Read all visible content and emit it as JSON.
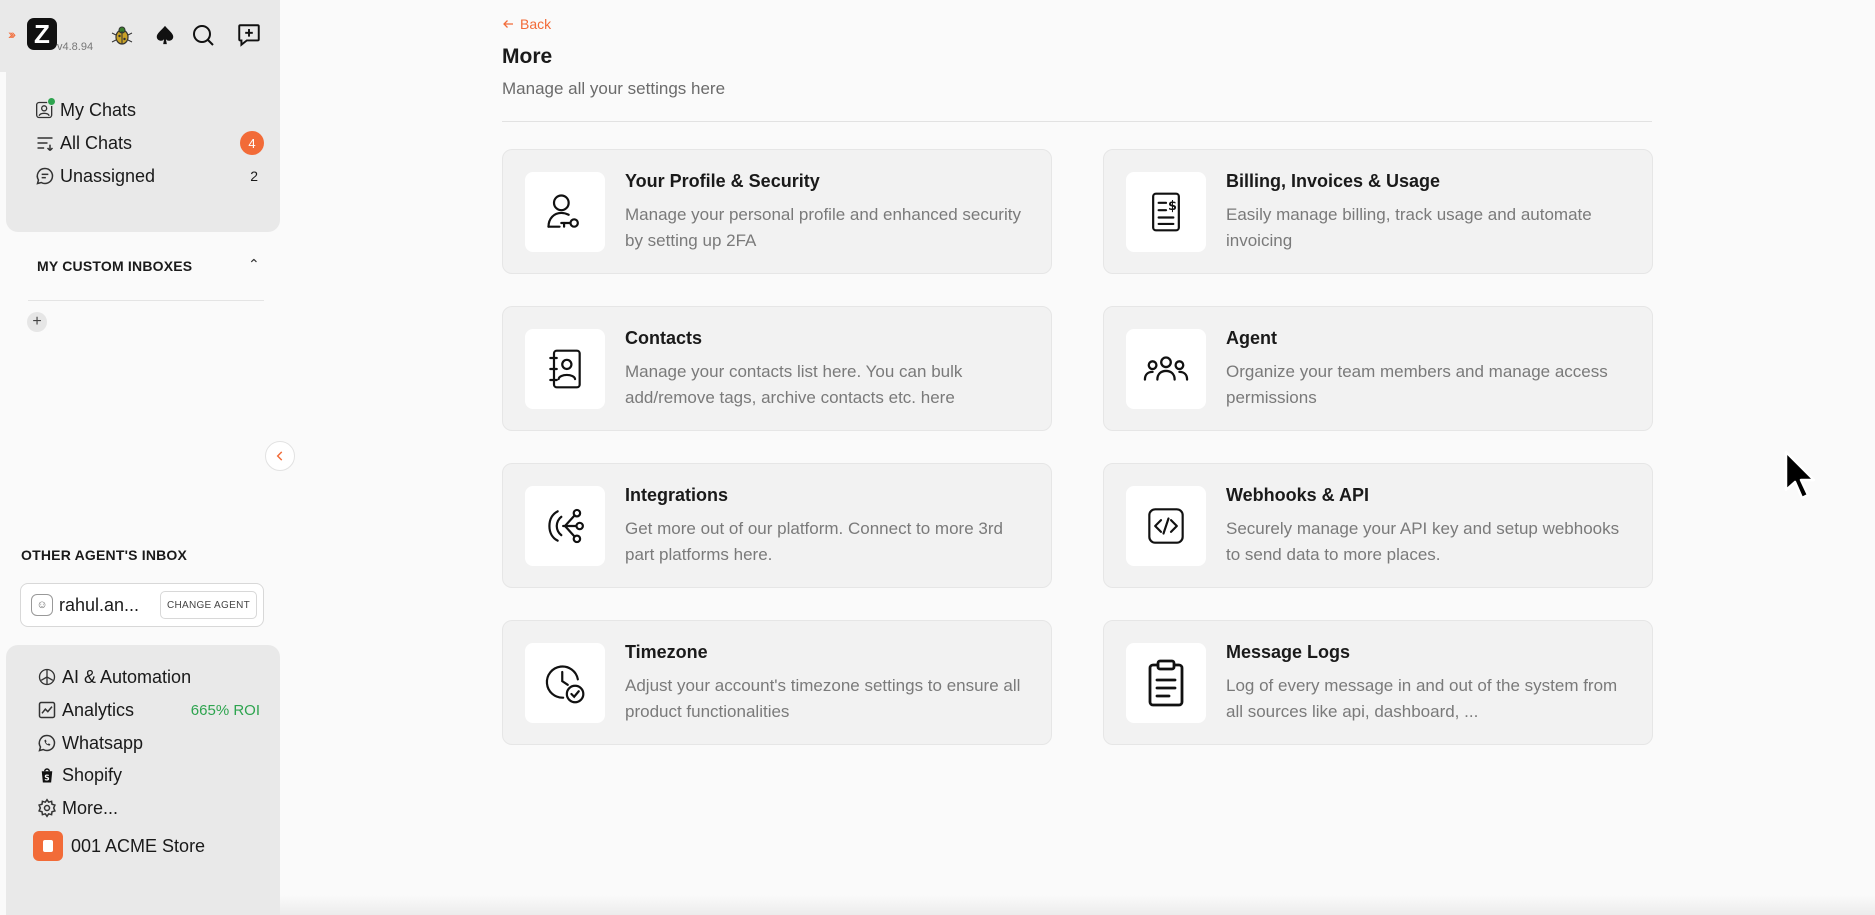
{
  "app": {
    "version": "v4.8.94"
  },
  "sidebar": {
    "nav": [
      {
        "label": "My Chats",
        "count": ""
      },
      {
        "label": "All Chats",
        "count": "4"
      },
      {
        "label": "Unassigned",
        "count": "2"
      }
    ],
    "custom_inboxes_title": "MY CUSTOM INBOXES",
    "other_agent_title": "OTHER AGENT'S INBOX",
    "agent_name": "rahul.an...",
    "change_agent_label": "CHANGE AGENT",
    "bottom": [
      {
        "label": "AI & Automation",
        "extra": ""
      },
      {
        "label": "Analytics",
        "extra": "665% ROI"
      },
      {
        "label": "Whatsapp",
        "extra": ""
      },
      {
        "label": "Shopify",
        "extra": ""
      },
      {
        "label": "More...",
        "extra": ""
      }
    ],
    "store_label": "001 ACME Store"
  },
  "main": {
    "back_label": "Back",
    "title": "More",
    "subtitle": "Manage all your settings here",
    "cards": [
      {
        "title": "Your Profile & Security",
        "desc": "Manage your personal profile and enhanced security by setting up 2FA",
        "icon": "profile-security-icon"
      },
      {
        "title": "Billing, Invoices & Usage",
        "desc": "Easily manage billing, track usage and automate invoicing",
        "icon": "billing-invoice-icon"
      },
      {
        "title": "Contacts",
        "desc": "Manage your contacts list here. You can bulk add/remove tags, archive contacts etc. here",
        "icon": "contacts-book-icon"
      },
      {
        "title": "Agent",
        "desc": "Organize your team members and manage access permissions",
        "icon": "team-agents-icon"
      },
      {
        "title": "Integrations",
        "desc": "Get more out of our platform. Connect to more 3rd part platforms here.",
        "icon": "integrations-icon"
      },
      {
        "title": "Webhooks & API",
        "desc": "Securely manage your API key and setup webhooks to send data to more places.",
        "icon": "code-api-icon"
      },
      {
        "title": "Timezone",
        "desc": "Adjust your account's timezone settings to ensure all product functionalities",
        "icon": "clock-check-icon"
      },
      {
        "title": "Message Logs",
        "desc": "Log of every message in and out of the system from all sources like api, dashboard, ...",
        "icon": "clipboard-log-icon"
      }
    ]
  },
  "colors": {
    "accent": "#f26b38",
    "roi_green": "#2ea44f"
  }
}
